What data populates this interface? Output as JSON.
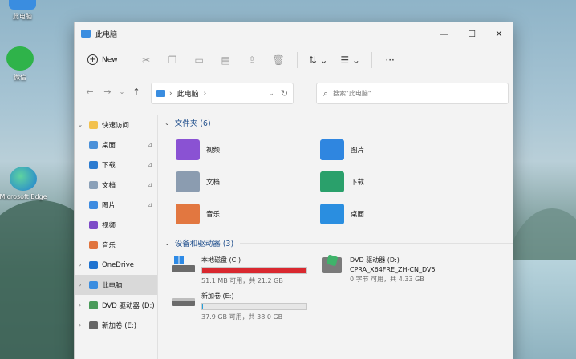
{
  "desktop": {
    "icons": [
      {
        "label": "此电脑"
      },
      {
        "label": "微信"
      },
      {
        "label": "Microsoft Edge"
      }
    ]
  },
  "window": {
    "title": "此电脑",
    "controls": [
      "—",
      "☐",
      "✕"
    ]
  },
  "toolbar": {
    "new_label": "New",
    "more": "···"
  },
  "address": {
    "path": "此电脑",
    "refresh": "↻",
    "search_placeholder": "搜索\"此电脑\""
  },
  "sidebar": {
    "items": [
      {
        "label": "快速访问",
        "chev": "⌄",
        "color": "#f2c14e",
        "indent": 0
      },
      {
        "label": "桌面",
        "pin": "📌",
        "color": "#4a90d9",
        "indent": 1
      },
      {
        "label": "下载",
        "pin": "📌",
        "color": "#2b7bd0",
        "indent": 1
      },
      {
        "label": "文档",
        "pin": "📌",
        "color": "#8aa0b8",
        "indent": 1
      },
      {
        "label": "图片",
        "pin": "📌",
        "color": "#3d8be0",
        "indent": 1
      },
      {
        "label": "视频",
        "color": "#7d4bc7",
        "indent": 1
      },
      {
        "label": "音乐",
        "color": "#e0743e",
        "indent": 1
      },
      {
        "label": "OneDrive",
        "chev": "›",
        "color": "#1e73d0",
        "indent": 0
      },
      {
        "label": "此电脑",
        "chev": "›",
        "color": "#3a8de0",
        "indent": 0,
        "selected": true
      },
      {
        "label": "DVD 驱动器 (D:)",
        "chev": "›",
        "color": "#4a9a5a",
        "indent": 0
      },
      {
        "label": "新加卷 (E:)",
        "chev": "›",
        "color": "#666666",
        "indent": 0
      }
    ]
  },
  "content": {
    "folders_header": "文件夹 (6)",
    "folders": [
      {
        "label": "视频",
        "color": "#8a52d3"
      },
      {
        "label": "图片",
        "color": "#2f86e0"
      },
      {
        "label": "文档",
        "color": "#8b9cb0"
      },
      {
        "label": "下载",
        "color": "#2aa06b"
      },
      {
        "label": "音乐",
        "color": "#e27740"
      },
      {
        "label": "桌面",
        "color": "#2a8ee0"
      }
    ],
    "drives_header": "设备和驱动器 (3)",
    "drives": [
      {
        "name": "本地磁盘 (C:)",
        "info": "51.1 MB 可用，共 21.2 GB",
        "used": 0.998,
        "bar_color": "#d9282f"
      },
      {
        "name": "新加卷 (E:)",
        "info": "37.9 GB 可用，共 38.0 GB",
        "used": 0.003,
        "bar_color": "#26a0da"
      },
      {
        "name": "DVD 驱动器 (D:)",
        "sub": "CPRA_X64FRE_ZH-CN_DV5",
        "info": "0 字节 可用，共 4.33 GB"
      }
    ]
  }
}
